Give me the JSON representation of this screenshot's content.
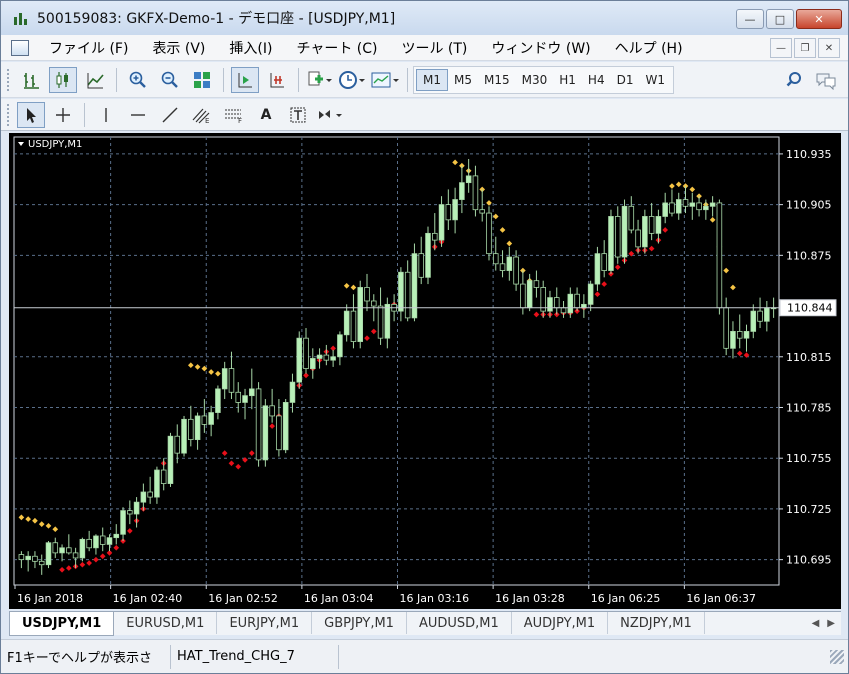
{
  "window": {
    "title": "500159083: GKFX-Demo-1 - デモ口座 - [USDJPY,M1]"
  },
  "menu": {
    "items": [
      "ファイル (F)",
      "表示 (V)",
      "挿入(I)",
      "チャート (C)",
      "ツール (T)",
      "ウィンドウ (W)",
      "ヘルプ (H)"
    ]
  },
  "toolbar": {
    "timeframes": [
      "M1",
      "M5",
      "M15",
      "M30",
      "H1",
      "H4",
      "D1",
      "W1"
    ],
    "active_timeframe": "M1",
    "text_tool_label": "A"
  },
  "chart": {
    "symbol_label": "USDJPY,M1",
    "current_price_label": "110.844",
    "bullish_color": "#b8f0b8",
    "bearish_color": "#000000",
    "wick_color": "#a8d8a8",
    "sar_bull_color": "#e8101a",
    "sar_bear_color": "#f5c445",
    "grid_color": "#5a6f8a"
  },
  "chart_data": {
    "type": "candlestick",
    "symbol": "USDJPY",
    "timeframe": "M1",
    "ylim": [
      110.68,
      110.945
    ],
    "y_ticks": [
      110.935,
      110.905,
      110.875,
      110.844,
      110.815,
      110.785,
      110.755,
      110.725,
      110.695
    ],
    "x_ticks": [
      "16 Jan 2018",
      "16 Jan 02:40",
      "16 Jan 02:52",
      "16 Jan 03:04",
      "16 Jan 03:16",
      "16 Jan 03:28",
      "16 Jan 06:25",
      "16 Jan 06:37"
    ],
    "grid": true,
    "candles": [
      [
        110.698,
        110.7,
        110.69,
        110.695
      ],
      [
        110.695,
        110.7,
        110.688,
        110.697
      ],
      [
        110.697,
        110.7,
        110.69,
        110.694
      ],
      [
        110.694,
        110.698,
        110.686,
        110.692
      ],
      [
        110.692,
        110.706,
        110.69,
        110.705
      ],
      [
        110.705,
        110.708,
        110.696,
        110.699
      ],
      [
        110.699,
        110.704,
        110.694,
        110.702
      ],
      [
        110.702,
        110.71,
        110.698,
        110.699
      ],
      [
        110.699,
        110.702,
        110.69,
        110.696
      ],
      [
        110.696,
        110.708,
        110.694,
        110.707
      ],
      [
        110.707,
        110.712,
        110.7,
        110.702
      ],
      [
        110.702,
        110.71,
        110.698,
        110.709
      ],
      [
        110.709,
        110.714,
        110.7,
        110.704
      ],
      [
        110.704,
        110.71,
        110.7,
        110.708
      ],
      [
        110.708,
        110.716,
        110.704,
        110.71
      ],
      [
        110.71,
        110.726,
        110.706,
        110.724
      ],
      [
        110.724,
        110.73,
        110.716,
        110.722
      ],
      [
        110.722,
        110.732,
        110.714,
        110.729
      ],
      [
        110.729,
        110.74,
        110.724,
        110.735
      ],
      [
        110.735,
        110.744,
        110.728,
        110.732
      ],
      [
        110.732,
        110.75,
        110.728,
        110.748
      ],
      [
        110.748,
        110.755,
        110.736,
        110.74
      ],
      [
        110.74,
        110.77,
        110.738,
        110.768
      ],
      [
        110.768,
        110.775,
        110.752,
        110.758
      ],
      [
        110.758,
        110.78,
        110.756,
        110.778
      ],
      [
        110.778,
        110.786,
        110.762,
        110.766
      ],
      [
        110.766,
        110.782,
        110.76,
        110.78
      ],
      [
        110.78,
        110.79,
        110.77,
        110.775
      ],
      [
        110.775,
        110.786,
        110.768,
        110.782
      ],
      [
        110.782,
        110.798,
        110.778,
        110.796
      ],
      [
        110.796,
        110.812,
        110.79,
        110.808
      ],
      [
        110.808,
        110.818,
        110.79,
        110.794
      ],
      [
        110.794,
        110.8,
        110.782,
        110.788
      ],
      [
        110.788,
        110.796,
        110.778,
        110.792
      ],
      [
        110.792,
        110.808,
        110.784,
        110.796
      ],
      [
        110.796,
        110.8,
        110.75,
        110.754
      ],
      [
        110.754,
        110.79,
        110.75,
        110.786
      ],
      [
        110.786,
        110.796,
        110.776,
        110.78
      ],
      [
        110.78,
        110.79,
        110.756,
        110.76
      ],
      [
        110.76,
        110.79,
        110.758,
        110.788
      ],
      [
        110.788,
        110.805,
        110.782,
        110.8
      ],
      [
        110.8,
        110.83,
        110.796,
        110.826
      ],
      [
        110.826,
        110.832,
        110.805,
        110.808
      ],
      [
        110.808,
        110.82,
        110.802,
        110.814
      ],
      [
        110.814,
        110.82,
        110.808,
        110.816
      ],
      [
        110.816,
        110.822,
        110.81,
        110.813
      ],
      [
        110.813,
        110.819,
        110.809,
        110.815
      ],
      [
        110.815,
        110.83,
        110.81,
        110.828
      ],
      [
        110.828,
        110.846,
        110.824,
        110.842
      ],
      [
        110.842,
        110.852,
        110.82,
        110.824
      ],
      [
        110.824,
        110.86,
        110.82,
        110.856
      ],
      [
        110.856,
        110.864,
        110.842,
        110.848
      ],
      [
        110.848,
        110.852,
        110.836,
        110.845
      ],
      [
        110.845,
        110.856,
        110.822,
        110.826
      ],
      [
        110.826,
        110.85,
        110.82,
        110.846
      ],
      [
        110.846,
        110.852,
        110.836,
        110.842
      ],
      [
        110.842,
        110.868,
        110.836,
        110.865
      ],
      [
        110.865,
        110.872,
        110.836,
        110.838
      ],
      [
        110.838,
        110.882,
        110.836,
        110.876
      ],
      [
        110.876,
        110.886,
        110.858,
        110.862
      ],
      [
        110.862,
        110.892,
        110.858,
        110.888
      ],
      [
        110.888,
        110.9,
        110.878,
        110.884
      ],
      [
        110.884,
        110.91,
        110.88,
        110.905
      ],
      [
        110.905,
        110.914,
        110.89,
        110.896
      ],
      [
        110.896,
        110.915,
        110.888,
        110.908
      ],
      [
        110.908,
        110.928,
        110.9,
        110.918
      ],
      [
        110.918,
        110.932,
        110.912,
        110.922
      ],
      [
        110.922,
        110.928,
        110.898,
        110.902
      ],
      [
        110.902,
        110.914,
        110.895,
        110.9
      ],
      [
        110.9,
        110.904,
        110.872,
        110.876
      ],
      [
        110.876,
        110.886,
        110.866,
        110.87
      ],
      [
        110.87,
        110.878,
        110.862,
        110.866
      ],
      [
        110.866,
        110.88,
        110.86,
        110.874
      ],
      [
        110.874,
        110.878,
        110.854,
        110.858
      ],
      [
        110.858,
        110.866,
        110.84,
        110.844
      ],
      [
        110.844,
        110.864,
        110.842,
        110.86
      ],
      [
        110.86,
        110.866,
        110.85,
        110.856
      ],
      [
        110.856,
        110.86,
        110.838,
        110.842
      ],
      [
        110.842,
        110.854,
        110.838,
        110.85
      ],
      [
        110.85,
        110.856,
        110.84,
        110.844
      ],
      [
        110.844,
        110.848,
        110.838,
        110.841
      ],
      [
        110.841,
        110.856,
        110.838,
        110.852
      ],
      [
        110.852,
        110.856,
        110.842,
        110.844
      ],
      [
        110.844,
        110.852,
        110.838,
        110.846
      ],
      [
        110.846,
        110.86,
        110.842,
        110.858
      ],
      [
        110.858,
        110.88,
        110.854,
        110.876
      ],
      [
        110.876,
        110.884,
        110.862,
        110.866
      ],
      [
        110.866,
        110.902,
        110.864,
        110.898
      ],
      [
        110.898,
        110.904,
        110.87,
        110.874
      ],
      [
        110.874,
        110.908,
        110.87,
        110.904
      ],
      [
        110.904,
        110.91,
        110.888,
        110.89
      ],
      [
        110.89,
        110.896,
        110.876,
        110.88
      ],
      [
        110.88,
        110.902,
        110.876,
        110.898
      ],
      [
        110.898,
        110.906,
        110.884,
        110.888
      ],
      [
        110.888,
        110.902,
        110.882,
        110.898
      ],
      [
        110.898,
        110.912,
        110.894,
        110.906
      ],
      [
        110.906,
        110.914,
        110.898,
        110.9
      ],
      [
        110.9,
        110.912,
        110.896,
        110.908
      ],
      [
        110.908,
        110.916,
        110.9,
        110.904
      ],
      [
        110.904,
        110.912,
        110.896,
        110.906
      ],
      [
        110.906,
        110.91,
        110.898,
        110.902
      ],
      [
        110.902,
        110.908,
        110.896,
        110.904
      ],
      [
        110.904,
        110.91,
        110.898,
        110.906
      ],
      [
        110.906,
        110.908,
        110.84,
        110.844
      ],
      [
        110.844,
        110.85,
        110.816,
        110.82
      ],
      [
        110.82,
        110.836,
        110.814,
        110.83
      ],
      [
        110.83,
        110.84,
        110.82,
        110.826
      ],
      [
        110.826,
        110.834,
        110.818,
        110.83
      ],
      [
        110.83,
        110.846,
        110.826,
        110.842
      ],
      [
        110.842,
        110.85,
        110.832,
        110.836
      ],
      [
        110.836,
        110.848,
        110.83,
        110.844
      ],
      [
        110.844,
        110.85,
        110.838,
        110.844
      ]
    ],
    "sar_bear": [
      [
        0,
        110.72
      ],
      [
        1,
        110.719
      ],
      [
        2,
        110.718
      ],
      [
        3,
        110.716
      ],
      [
        4,
        110.715
      ],
      [
        5,
        110.713
      ],
      [
        25,
        110.81
      ],
      [
        26,
        110.809
      ],
      [
        27,
        110.808
      ],
      [
        28,
        110.806
      ],
      [
        29,
        110.805
      ],
      [
        48,
        110.857
      ],
      [
        49,
        110.856
      ],
      [
        50,
        110.855
      ],
      [
        64,
        110.93
      ],
      [
        65,
        110.928
      ],
      [
        66,
        110.925
      ],
      [
        67,
        110.92
      ],
      [
        68,
        110.914
      ],
      [
        69,
        110.906
      ],
      [
        70,
        110.898
      ],
      [
        71,
        110.89
      ],
      [
        72,
        110.882
      ],
      [
        73,
        110.873
      ],
      [
        74,
        110.866
      ],
      [
        75,
        110.86
      ],
      [
        96,
        110.916
      ],
      [
        97,
        110.917
      ],
      [
        98,
        110.916
      ],
      [
        99,
        110.914
      ],
      [
        100,
        110.91
      ],
      [
        101,
        110.905
      ],
      [
        102,
        110.896
      ],
      [
        103,
        110.88
      ],
      [
        104,
        110.866
      ],
      [
        105,
        110.856
      ]
    ],
    "sar_bull": [
      [
        6,
        110.689
      ],
      [
        7,
        110.69
      ],
      [
        8,
        110.691
      ],
      [
        9,
        110.692
      ],
      [
        10,
        110.693
      ],
      [
        11,
        110.695
      ],
      [
        12,
        110.697
      ],
      [
        13,
        110.699
      ],
      [
        14,
        110.702
      ],
      [
        15,
        110.706
      ],
      [
        16,
        110.712
      ],
      [
        17,
        110.718
      ],
      [
        18,
        110.725
      ],
      [
        19,
        110.733
      ],
      [
        20,
        110.742
      ],
      [
        21,
        110.752
      ],
      [
        22,
        110.758
      ],
      [
        23,
        110.766
      ],
      [
        24,
        110.774
      ],
      [
        30,
        110.758
      ],
      [
        31,
        110.752
      ],
      [
        32,
        110.75
      ],
      [
        33,
        110.754
      ],
      [
        34,
        110.758
      ],
      [
        35,
        110.763
      ],
      [
        36,
        110.768
      ],
      [
        37,
        110.774
      ],
      [
        38,
        110.78
      ],
      [
        39,
        110.786
      ],
      [
        40,
        110.792
      ],
      [
        41,
        110.798
      ],
      [
        42,
        110.804
      ],
      [
        43,
        110.808
      ],
      [
        44,
        110.813
      ],
      [
        45,
        110.818
      ],
      [
        46,
        110.82
      ],
      [
        47,
        110.822
      ],
      [
        51,
        110.826
      ],
      [
        52,
        110.83
      ],
      [
        53,
        110.834
      ],
      [
        54,
        110.84
      ],
      [
        55,
        110.846
      ],
      [
        56,
        110.852
      ],
      [
        57,
        110.858
      ],
      [
        58,
        110.864
      ],
      [
        59,
        110.87
      ],
      [
        60,
        110.876
      ],
      [
        61,
        110.88
      ],
      [
        62,
        110.883
      ],
      [
        76,
        110.84
      ],
      [
        77,
        110.84
      ],
      [
        78,
        110.84
      ],
      [
        79,
        110.84
      ],
      [
        80,
        110.841
      ],
      [
        81,
        110.841
      ],
      [
        82,
        110.842
      ],
      [
        83,
        110.844
      ],
      [
        84,
        110.847
      ],
      [
        85,
        110.852
      ],
      [
        86,
        110.858
      ],
      [
        87,
        110.864
      ],
      [
        88,
        110.868
      ],
      [
        89,
        110.872
      ],
      [
        90,
        110.876
      ],
      [
        91,
        110.878
      ],
      [
        92,
        110.878
      ],
      [
        93,
        110.879
      ],
      [
        94,
        110.884
      ],
      [
        95,
        110.89
      ],
      [
        106,
        110.817
      ],
      [
        107,
        110.816
      ]
    ]
  },
  "tabs": [
    "USDJPY,M1",
    "EURUSD,M1",
    "EURJPY,M1",
    "GBPJPY,M1",
    "AUDUSD,M1",
    "AUDJPY,M1",
    "NZDJPY,M1"
  ],
  "active_tab": "USDJPY,M1",
  "status": {
    "help_text": "F1キーでヘルプが表示さ",
    "profile": "HAT_Trend_CHG_7"
  }
}
